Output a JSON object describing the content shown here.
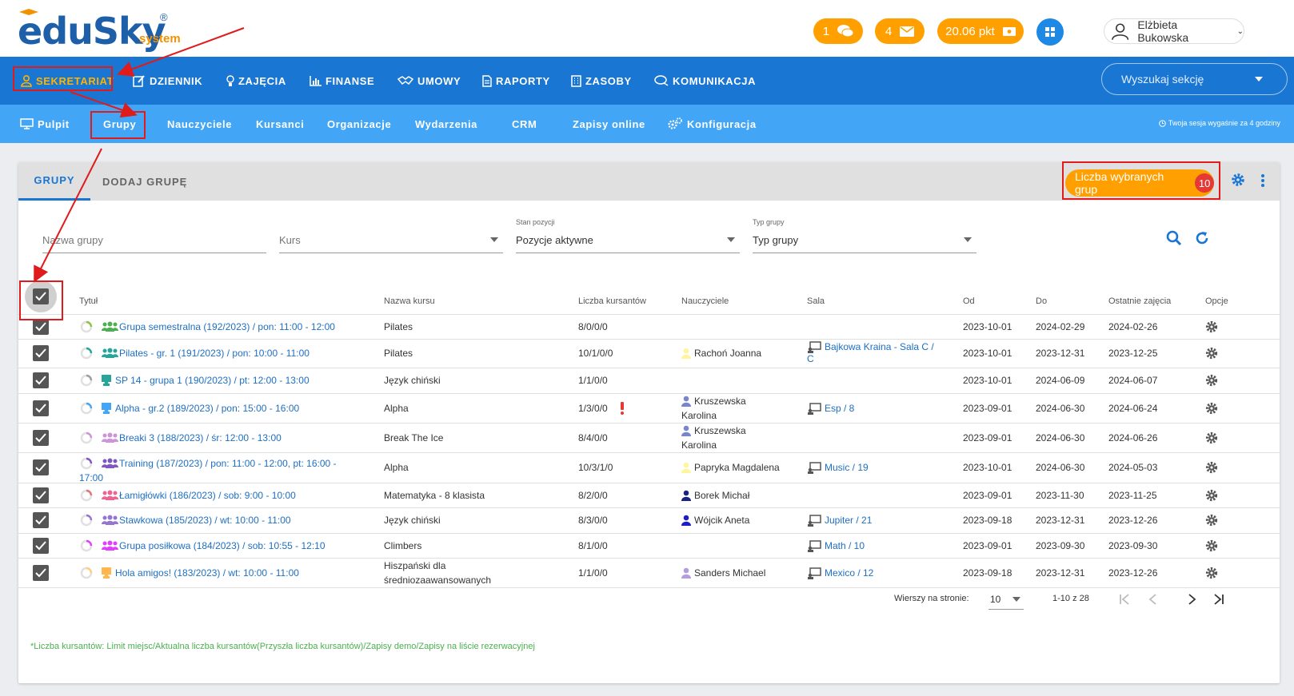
{
  "app": {
    "logo_text": "eduSky",
    "logo_sub": "system",
    "logo_reg": "®"
  },
  "header": {
    "chat_count": "1",
    "mail_count": "4",
    "points": "20.06 pkt",
    "user_name": "Elżbieta Bukowska"
  },
  "main_nav": {
    "items": [
      {
        "label": "SEKRETARIAT",
        "icon": "person-icon"
      },
      {
        "label": "DZIENNIK",
        "icon": "edit-icon"
      },
      {
        "label": "ZAJĘCIA",
        "icon": "lightbulb-icon"
      },
      {
        "label": "FINANSE",
        "icon": "bar-chart-icon"
      },
      {
        "label": "UMOWY",
        "icon": "handshake-icon"
      },
      {
        "label": "RAPORTY",
        "icon": "document-icon"
      },
      {
        "label": "ZASOBY",
        "icon": "building-icon"
      },
      {
        "label": "KOMUNIKACJA",
        "icon": "chat-icon"
      }
    ],
    "search_placeholder": "Wyszukaj sekcję"
  },
  "sub_nav": {
    "items": [
      {
        "label": "Pulpit"
      },
      {
        "label": "Grupy"
      },
      {
        "label": "Nauczyciele"
      },
      {
        "label": "Kursanci"
      },
      {
        "label": "Organizacje"
      },
      {
        "label": "Wydarzenia"
      },
      {
        "label": "CRM"
      },
      {
        "label": "Zapisy online"
      },
      {
        "label": "Konfiguracja"
      }
    ],
    "session_note": "Twoja sesja wygaśnie za 4 godziny"
  },
  "card": {
    "tabs": [
      "GRUPY",
      "DODAJ GRUPĘ"
    ],
    "selected_label": "Liczba wybranych grup",
    "selected_count": "10"
  },
  "filters": {
    "group_name_placeholder": "Nazwa grupy",
    "course_placeholder": "Kurs",
    "state_label": "Stan pozycji",
    "state_value": "Pozycje aktywne",
    "type_label": "Typ grupy",
    "type_value": "Typ grupy"
  },
  "table": {
    "headers": {
      "title": "Tytuł",
      "course": "Nazwa kursu",
      "students": "Liczba kursantów",
      "teachers": "Nauczyciele",
      "room": "Sala",
      "from": "Od",
      "to": "Do",
      "last": "Ostatnie zajęcia",
      "options": "Opcje"
    },
    "rows": [
      {
        "title": "Grupa semestralna (192/2023) / pon: 11:00 - 12:00",
        "title2": "",
        "course": "Pilates",
        "course2": "",
        "students": "8/0/0/0",
        "teacher": "",
        "teacher2": "",
        "room": "",
        "room2": "",
        "from": "2023-10-01",
        "to": "2024-02-29",
        "last": "2024-02-26"
      },
      {
        "title": "Pilates - gr. 1 (191/2023) / pon: 10:00 - 11:00",
        "title2": "",
        "course": "Pilates",
        "course2": "",
        "students": "10/1/0/0",
        "teacher": "Rachoń Joanna",
        "teacher2": "",
        "room": "Bajkowa Kraina - Sala C /",
        "room2": "C",
        "from": "2023-10-01",
        "to": "2023-12-31",
        "last": "2023-12-25"
      },
      {
        "title": "SP 14 - grupa 1 (190/2023) / pt: 12:00 - 13:00",
        "title2": "",
        "course": "Język chiński",
        "course2": "",
        "students": "1/1/0/0",
        "teacher": "",
        "teacher2": "",
        "room": "",
        "room2": "",
        "from": "2023-10-01",
        "to": "2024-06-09",
        "last": "2024-06-07"
      },
      {
        "title": "Alpha - gr.2 (189/2023) / pon: 15:00 - 16:00",
        "title2": "",
        "course": "Alpha",
        "course2": "",
        "students": "1/3/0/0",
        "teacher": "Kruszewska",
        "teacher2": "Karolina",
        "room": "Esp / 8",
        "room2": "",
        "from": "2023-09-01",
        "to": "2024-06-30",
        "last": "2024-06-24"
      },
      {
        "title": "Breaki 3 (188/2023) / śr: 12:00 - 13:00",
        "title2": "",
        "course": "Break The Ice",
        "course2": "",
        "students": "8/4/0/0",
        "teacher": "Kruszewska",
        "teacher2": "Karolina",
        "room": "",
        "room2": "",
        "from": "2023-09-01",
        "to": "2024-06-30",
        "last": "2024-06-26"
      },
      {
        "title": "Training (187/2023) / pon: 11:00 - 12:00, pt: 16:00 -",
        "title2": "17:00",
        "course": "Alpha",
        "course2": "",
        "students": "10/3/1/0",
        "teacher": "Papryka Magdalena",
        "teacher2": "",
        "room": "Music / 19",
        "room2": "",
        "from": "2023-10-01",
        "to": "2024-06-30",
        "last": "2024-05-03"
      },
      {
        "title": "Łamigłówki (186/2023) / sob: 9:00 - 10:00",
        "title2": "",
        "course": "Matematyka - 8 klasista",
        "course2": "",
        "students": "8/2/0/0",
        "teacher": "Borek Michał",
        "teacher2": "",
        "room": "",
        "room2": "",
        "from": "2023-09-01",
        "to": "2023-11-30",
        "last": "2023-11-25"
      },
      {
        "title": "Stawkowa (185/2023) / wt: 10:00 - 11:00",
        "title2": "",
        "course": "Język chiński",
        "course2": "",
        "students": "8/3/0/0",
        "teacher": "Wójcik Aneta",
        "teacher2": "",
        "room": "Jupiter / 21",
        "room2": "",
        "from": "2023-09-18",
        "to": "2023-12-31",
        "last": "2023-12-26"
      },
      {
        "title": "Grupa posiłkowa (184/2023) / sob: 10:55 - 12:10",
        "title2": "",
        "course": "Climbers",
        "course2": "",
        "students": "8/1/0/0",
        "teacher": "",
        "teacher2": "",
        "room": "Math / 10",
        "room2": "",
        "from": "2023-09-01",
        "to": "2023-09-30",
        "last": "2023-09-30"
      },
      {
        "title": "Hola amigos! (183/2023) / wt: 10:00 - 11:00",
        "title2": "",
        "course": "Hiszpański dla",
        "course2": "średniozaawansowanych",
        "students": "1/1/0/0",
        "teacher": "Sanders Michael",
        "teacher2": "",
        "room": "Mexico / 12",
        "room2": "",
        "from": "2023-09-18",
        "to": "2023-12-31",
        "last": "2023-12-26"
      }
    ]
  },
  "pagination": {
    "rows_per_page_label": "Wierszy na stronie:",
    "rows_per_page": "10",
    "range": "1-10 z 28"
  },
  "footnote": "*Liczba kursantów: Limit miejsc/Aktualna liczba kursantów(Przyszła liczba kursantów)/Zapisy demo/Zapisy na liście rezerwacyjnej",
  "colors": {
    "brand_blue": "#1976d2",
    "sub_blue": "#42a5f5",
    "accent_orange": "#ffa000",
    "highlight_red": "#e01b1b",
    "link": "#1e6fc2"
  }
}
